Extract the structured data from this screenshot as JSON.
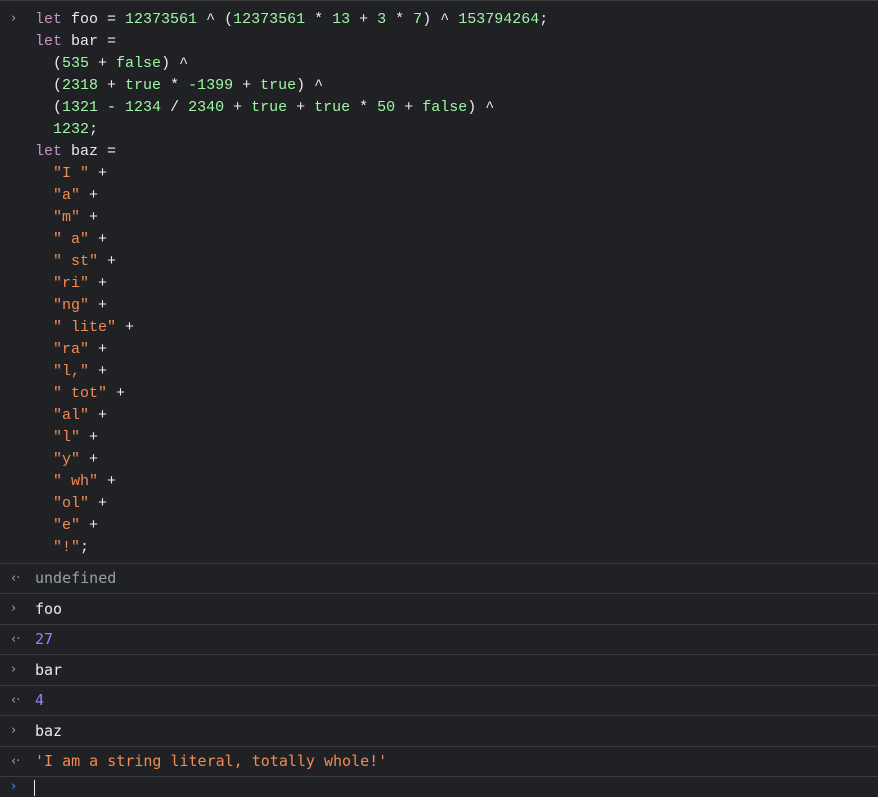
{
  "prompts": {
    "input": "›",
    "output": "‹·"
  },
  "entries": [
    {
      "kind": "input",
      "lines": [
        [
          [
            "kw",
            "let "
          ],
          [
            "id",
            "foo "
          ],
          [
            "op",
            "= "
          ],
          [
            "num",
            "12373561"
          ],
          [
            "op",
            " ^ ("
          ],
          [
            "num",
            "12373561"
          ],
          [
            "op",
            " * "
          ],
          [
            "num",
            "13"
          ],
          [
            "op",
            " + "
          ],
          [
            "num",
            "3"
          ],
          [
            "op",
            " * "
          ],
          [
            "num",
            "7"
          ],
          [
            "op",
            ") ^ "
          ],
          [
            "num",
            "153794264"
          ],
          [
            "op",
            ";"
          ]
        ],
        [
          [
            "kw",
            "let "
          ],
          [
            "id",
            "bar "
          ],
          [
            "op",
            "="
          ]
        ],
        [
          [
            "op",
            "  ("
          ],
          [
            "num",
            "535"
          ],
          [
            "op",
            " + "
          ],
          [
            "lit",
            "false"
          ],
          [
            "op",
            ") ^"
          ]
        ],
        [
          [
            "op",
            "  ("
          ],
          [
            "num",
            "2318"
          ],
          [
            "op",
            " + "
          ],
          [
            "lit",
            "true"
          ],
          [
            "op",
            " * "
          ],
          [
            "num",
            "-1399"
          ],
          [
            "op",
            " + "
          ],
          [
            "lit",
            "true"
          ],
          [
            "op",
            ") ^"
          ]
        ],
        [
          [
            "op",
            "  ("
          ],
          [
            "num",
            "1321"
          ],
          [
            "op",
            " - "
          ],
          [
            "num",
            "1234"
          ],
          [
            "op",
            " / "
          ],
          [
            "num",
            "2340"
          ],
          [
            "op",
            " + "
          ],
          [
            "lit",
            "true"
          ],
          [
            "op",
            " + "
          ],
          [
            "lit",
            "true"
          ],
          [
            "op",
            " * "
          ],
          [
            "num",
            "50"
          ],
          [
            "op",
            " + "
          ],
          [
            "lit",
            "false"
          ],
          [
            "op",
            ") ^"
          ]
        ],
        [
          [
            "op",
            "  "
          ],
          [
            "num",
            "1232"
          ],
          [
            "op",
            ";"
          ]
        ],
        [
          [
            "kw",
            "let "
          ],
          [
            "id",
            "baz "
          ],
          [
            "op",
            "="
          ]
        ],
        [
          [
            "op",
            "  "
          ],
          [
            "str",
            "\"I \""
          ],
          [
            "op",
            " +"
          ]
        ],
        [
          [
            "op",
            "  "
          ],
          [
            "str",
            "\"a\""
          ],
          [
            "op",
            " +"
          ]
        ],
        [
          [
            "op",
            "  "
          ],
          [
            "str",
            "\"m\""
          ],
          [
            "op",
            " +"
          ]
        ],
        [
          [
            "op",
            "  "
          ],
          [
            "str",
            "\" a\""
          ],
          [
            "op",
            " +"
          ]
        ],
        [
          [
            "op",
            "  "
          ],
          [
            "str",
            "\" st\""
          ],
          [
            "op",
            " +"
          ]
        ],
        [
          [
            "op",
            "  "
          ],
          [
            "str",
            "\"ri\""
          ],
          [
            "op",
            " +"
          ]
        ],
        [
          [
            "op",
            "  "
          ],
          [
            "str",
            "\"ng\""
          ],
          [
            "op",
            " +"
          ]
        ],
        [
          [
            "op",
            "  "
          ],
          [
            "str",
            "\" lite\""
          ],
          [
            "op",
            " +"
          ]
        ],
        [
          [
            "op",
            "  "
          ],
          [
            "str",
            "\"ra\""
          ],
          [
            "op",
            " +"
          ]
        ],
        [
          [
            "op",
            "  "
          ],
          [
            "str",
            "\"l,\""
          ],
          [
            "op",
            " +"
          ]
        ],
        [
          [
            "op",
            "  "
          ],
          [
            "str",
            "\" tot\""
          ],
          [
            "op",
            " +"
          ]
        ],
        [
          [
            "op",
            "  "
          ],
          [
            "str",
            "\"al\""
          ],
          [
            "op",
            " +"
          ]
        ],
        [
          [
            "op",
            "  "
          ],
          [
            "str",
            "\"l\""
          ],
          [
            "op",
            " +"
          ]
        ],
        [
          [
            "op",
            "  "
          ],
          [
            "str",
            "\"y\""
          ],
          [
            "op",
            " +"
          ]
        ],
        [
          [
            "op",
            "  "
          ],
          [
            "str",
            "\" wh\""
          ],
          [
            "op",
            " +"
          ]
        ],
        [
          [
            "op",
            "  "
          ],
          [
            "str",
            "\"ol\""
          ],
          [
            "op",
            " +"
          ]
        ],
        [
          [
            "op",
            "  "
          ],
          [
            "str",
            "\"e\""
          ],
          [
            "op",
            " +"
          ]
        ],
        [
          [
            "op",
            "  "
          ],
          [
            "str",
            "\"!\""
          ],
          [
            "op",
            ";"
          ]
        ]
      ]
    },
    {
      "kind": "output",
      "value": "undefined",
      "type": "undef"
    },
    {
      "kind": "simple-input",
      "value": "foo"
    },
    {
      "kind": "output",
      "value": "27",
      "type": "num"
    },
    {
      "kind": "simple-input",
      "value": "bar"
    },
    {
      "kind": "output",
      "value": "4",
      "type": "num"
    },
    {
      "kind": "simple-input",
      "value": "baz"
    },
    {
      "kind": "output",
      "value": "'I am a string literal, totally whole!'",
      "type": "str"
    }
  ]
}
